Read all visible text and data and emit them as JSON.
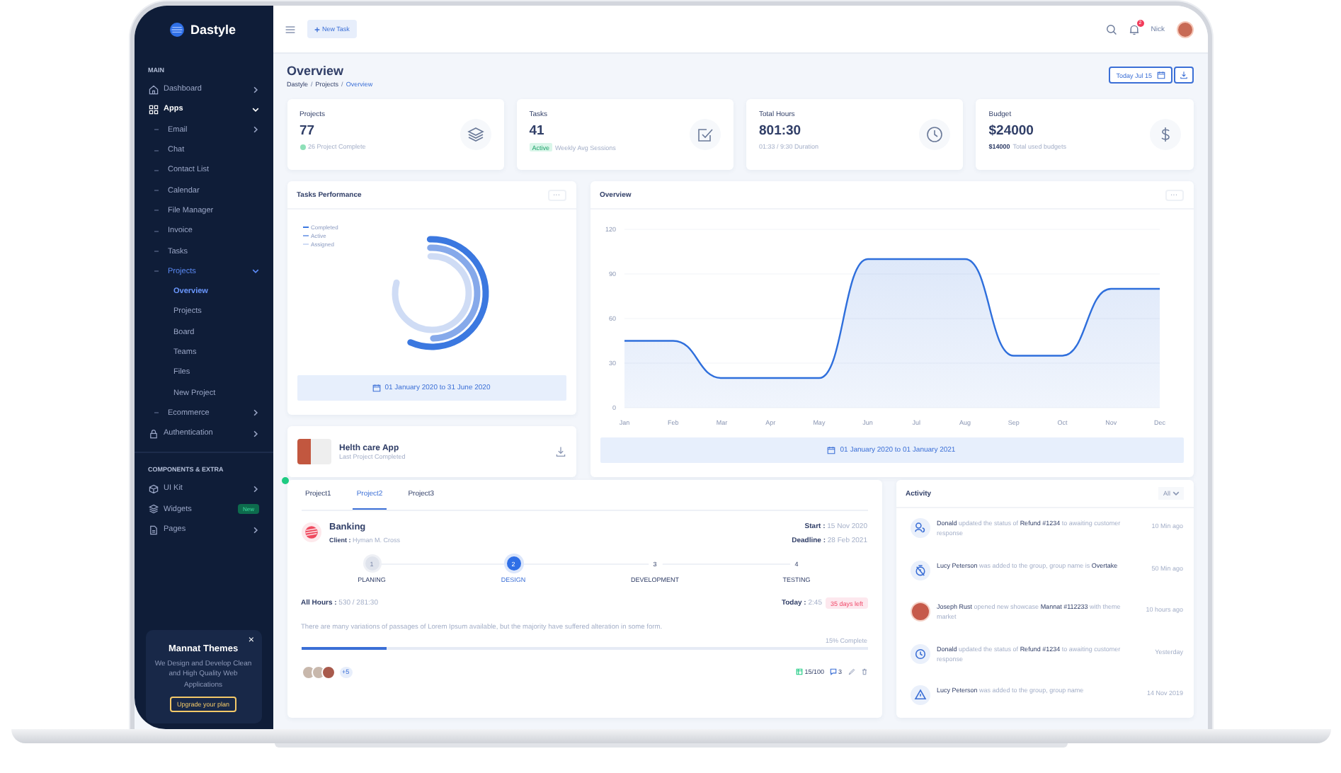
{
  "brand": {
    "name": "Dastyle"
  },
  "topbar": {
    "new_task": "New Task",
    "notifications": "2",
    "user": "Nick"
  },
  "sidebar": {
    "sections": [
      {
        "title": "MAIN",
        "items": [
          {
            "label": "Dashboard",
            "selected": false,
            "expanded": false
          },
          {
            "label": "Apps",
            "selected": false,
            "expanded": true,
            "children": [
              {
                "label": "Email",
                "selected": false,
                "expanded": false
              },
              {
                "label": "Chat",
                "selected": false
              },
              {
                "label": "Contact List",
                "selected": false
              },
              {
                "label": "Calendar",
                "selected": false
              },
              {
                "label": "File Manager",
                "selected": false
              },
              {
                "label": "Invoice",
                "selected": false
              },
              {
                "label": "Tasks",
                "selected": false
              },
              {
                "label": "Projects",
                "selected": false,
                "expanded": true,
                "children": [
                  {
                    "label": "Overview",
                    "selected": true
                  },
                  {
                    "label": "Projects",
                    "selected": false
                  },
                  {
                    "label": "Board",
                    "selected": false
                  },
                  {
                    "label": "Teams",
                    "selected": false
                  },
                  {
                    "label": "Files",
                    "selected": false
                  },
                  {
                    "label": "New Project",
                    "selected": false
                  }
                ]
              },
              {
                "label": "Ecommerce",
                "selected": false,
                "expanded": false
              }
            ]
          },
          {
            "label": "Authentication",
            "selected": false,
            "expanded": false
          }
        ]
      },
      {
        "title": "COMPONENTS & EXTRA",
        "items": [
          {
            "label": "UI Kit",
            "selected": false,
            "expanded": false
          },
          {
            "label": "Widgets",
            "selected": false,
            "badge": "New"
          },
          {
            "label": "Pages",
            "selected": false,
            "expanded": false
          }
        ]
      }
    ]
  },
  "promo": {
    "close": "×",
    "title": "Mannat Themes",
    "text": "We Design and Develop Clean and High Quality Web Applications",
    "button": "Upgrade your plan"
  },
  "page": {
    "title": "Overview",
    "breadcrumb": [
      "Dastyle",
      "/",
      "Projects",
      "/",
      "Overview"
    ],
    "date_label": "Today",
    "date": "Jul 15"
  },
  "stats": [
    {
      "kind": "dot",
      "title": "Projects",
      "value": "77",
      "note": "26 Project Complete"
    },
    {
      "kind": "badge",
      "title": "Tasks",
      "value": "41",
      "badge": "Active",
      "note": "Weekly Avg Sessions"
    },
    {
      "kind": "plain",
      "title": "Total Hours",
      "value": "801:30",
      "note": "01:33 / 9:30 Duration"
    },
    {
      "kind": "lead",
      "title": "Budget",
      "value": "$24000",
      "lead": "$14000",
      "note": "Total used budgets"
    }
  ],
  "tasks_performance": {
    "title": "Tasks Performance",
    "menu": "···",
    "legend": [
      {
        "label": "Completed",
        "color": "#3b78e0"
      },
      {
        "label": "Active",
        "color": "#86a9ea"
      },
      {
        "label": "Assigned",
        "color": "#cfdcf5"
      }
    ],
    "date_range": "01 January 2020 to 31 June 2020"
  },
  "last_project": {
    "title": "Helth care App",
    "subtitle": "Last Project Completed"
  },
  "overview": {
    "title": "Overview",
    "menu": "···",
    "chart_data": {
      "type": "area",
      "categories": [
        "Jan",
        "Feb",
        "Mar",
        "Apr",
        "May",
        "Jun",
        "Jul",
        "Aug",
        "Sep",
        "Oct",
        "Nov",
        "Dec"
      ],
      "series": [
        {
          "color": "#2f6fdc",
          "values": [
            45,
            45,
            20,
            20,
            20,
            100,
            100,
            100,
            35,
            35,
            80,
            80
          ]
        }
      ],
      "ylim": [
        0,
        120
      ],
      "yticks": [
        0,
        30,
        60,
        90,
        120
      ],
      "grid": true
    },
    "date_range": "01 January 2020 to 01 January 2021"
  },
  "project": {
    "tabs": [
      {
        "label": "Project1",
        "selected": false
      },
      {
        "label": "Project2",
        "selected": true
      },
      {
        "label": "Project3",
        "selected": false
      }
    ],
    "name": "Banking",
    "client_label": "Client :",
    "client": "Hyman M. Cross",
    "start_label": "Start :",
    "start": "15 Nov 2020",
    "deadline_label": "Deadline :",
    "deadline": "28 Feb 2021",
    "steps": [
      {
        "number": "1",
        "label": "PLANING",
        "completed": true,
        "selected": false
      },
      {
        "number": "2",
        "label": "DESIGN",
        "completed": false,
        "selected": true
      },
      {
        "number": "3",
        "label": "DEVELOPMENT",
        "completed": false,
        "selected": false
      },
      {
        "number": "4",
        "label": "TESTING",
        "completed": false,
        "selected": false
      }
    ],
    "hours_label": "All Hours :",
    "hours": "530 / 281:30",
    "today_label": "Today :",
    "today": "2:45",
    "days_left": "35 days left",
    "description": "There are many variations of passages of Lorem Ipsum available, but the majority have suffered alteration in some form.",
    "progress": {
      "level": 0.15,
      "reading": "15% Complete"
    },
    "more_members": "+5",
    "tasks": "15/100",
    "comments": "3"
  },
  "activity": {
    "title": "Activity",
    "filter": "All",
    "items": [
      {
        "kind": "icon",
        "text": "**Donald** updated the status of **Refund #1234** to awaiting customer response",
        "time": "10 Min ago"
      },
      {
        "kind": "icon",
        "text": "**Lucy Peterson** was added to the group, group name is **Overtake**",
        "time": "50 Min ago"
      },
      {
        "kind": "avatar",
        "text": "**Joseph Rust** opened new showcase **Mannat #112233** with theme market",
        "time": "10 hours ago"
      },
      {
        "kind": "icon",
        "text": "**Donald** updated the status of **Refund #1234** to awaiting customer response",
        "time": "Yesterday"
      },
      {
        "kind": "icon",
        "text": "**Lucy Peterson** was added to the group, group name",
        "time": "14 Nov 2019"
      }
    ]
  }
}
